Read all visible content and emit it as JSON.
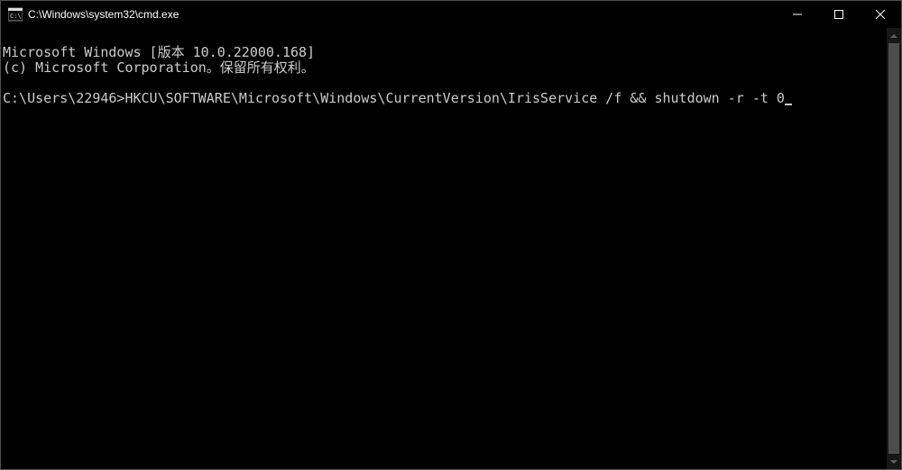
{
  "titlebar": {
    "title": "C:\\Windows\\system32\\cmd.exe"
  },
  "terminal": {
    "line1": "Microsoft Windows [版本 10.0.22000.168]",
    "line2": "(c) Microsoft Corporation。保留所有权利。",
    "blank": "",
    "prompt": "C:\\Users\\22946>",
    "command": "HKCU\\SOFTWARE\\Microsoft\\Windows\\CurrentVersion\\IrisService /f && shutdown -r -t 0"
  }
}
